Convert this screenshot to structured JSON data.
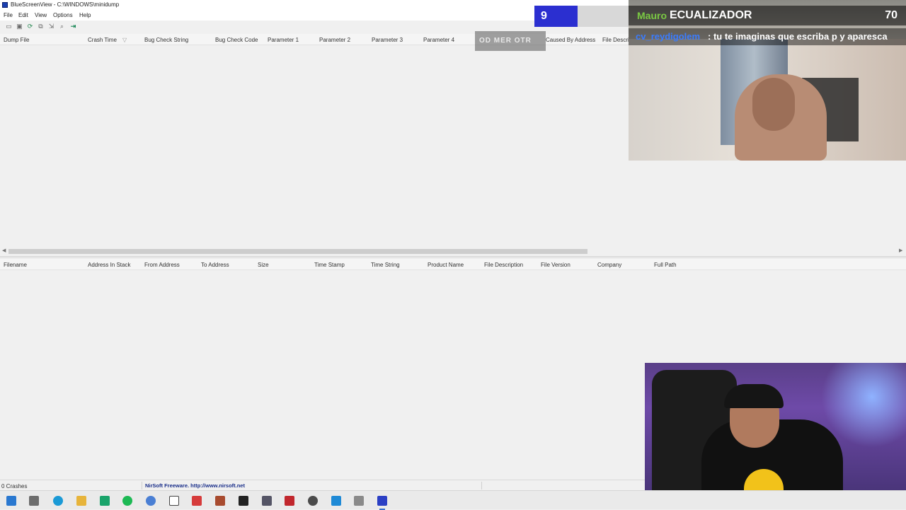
{
  "window": {
    "title": "BlueScreenView - C:\\WINDOWS\\minidump"
  },
  "menu": [
    "File",
    "Edit",
    "View",
    "Options",
    "Help"
  ],
  "toolbar": {
    "icons": [
      "properties-icon",
      "save-icon",
      "refresh-icon",
      "copy-icon",
      "export-icon",
      "find-icon",
      "exit-icon"
    ]
  },
  "upper_table": {
    "columns": [
      "Dump File",
      "Crash Time",
      "Bug Check String",
      "Bug Check Code",
      "Parameter 1",
      "Parameter 2",
      "Parameter 3",
      "Parameter 4",
      "Caused By Address",
      "File Descri"
    ],
    "sort_indicator": "▽",
    "rows": []
  },
  "lower_table": {
    "columns": [
      "Filename",
      "Address In Stack",
      "From Address",
      "To Address",
      "Size",
      "Time Stamp",
      "Time String",
      "Product Name",
      "File Description",
      "File Version",
      "Company",
      "Full Path"
    ],
    "rows": []
  },
  "status": {
    "count": "0 Crashes",
    "credit": "NirSoft Freeware.  http://www.nirsoft.net"
  },
  "overlay": {
    "hype_level": "9",
    "chat_user1": "Mauro",
    "chat_title": "ECUALIZADOR",
    "chat_number": "70",
    "chat_user2": "cv_reydigolem",
    "chat_msg2": ": tu te imaginas que escriba p y aparesca",
    "badge_text": "OD MER OTR"
  },
  "taskbar": {
    "apps": [
      "windows-start-icon",
      "task-view-icon",
      "edge-icon",
      "file-explorer-icon",
      "app-green-icon",
      "spotify-icon",
      "chrome-icon",
      "broadcast-icon",
      "app-red-icon",
      "app-grid-icon",
      "terminal-icon",
      "app-monitor-icon",
      "pdf-icon",
      "clock-icon",
      "app-window-icon",
      "app-gray-icon",
      "bluescreenview-icon"
    ]
  },
  "colors": {
    "accent": "#2b2fd0",
    "credit_link": "#1a2f8a",
    "chat_user_green": "#7ac943",
    "chat_user_blue": "#3a7cff"
  }
}
